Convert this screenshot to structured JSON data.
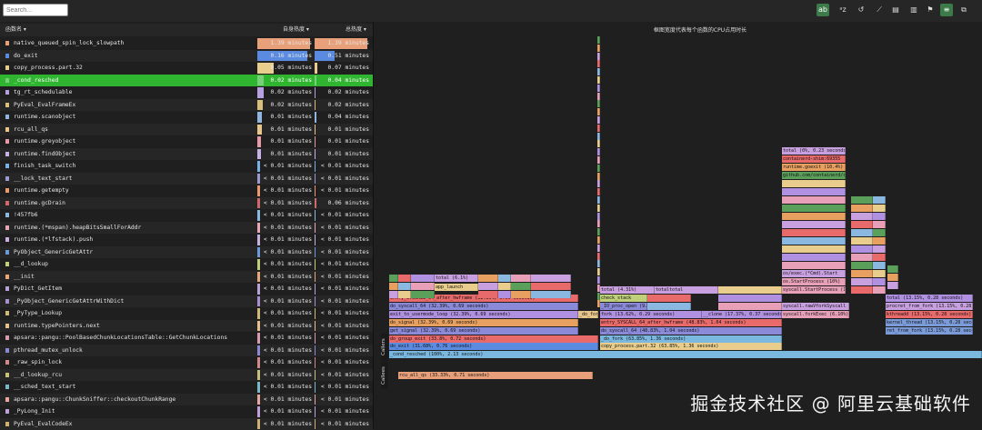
{
  "search": {
    "placeholder": "Search..."
  },
  "toolbar": {
    "buttons": [
      {
        "label": "ab",
        "icon": "match-case-icon",
        "active": true
      },
      {
        "label": "ᵃz",
        "icon": "sort-alpha-icon",
        "active": false
      },
      {
        "label": "↺",
        "icon": "reset-icon",
        "active": false
      },
      {
        "label": "⟋",
        "icon": "highlight-icon",
        "active": false
      },
      {
        "label": "▤",
        "icon": "table-icon",
        "active": false
      },
      {
        "label": "▥",
        "icon": "split-icon",
        "active": false
      },
      {
        "label": "⚑",
        "icon": "flag-icon",
        "active": false
      },
      {
        "label": "≡",
        "icon": "flamegraph-icon",
        "active": true
      },
      {
        "label": "⧉",
        "icon": "graph-icon",
        "active": false
      }
    ]
  },
  "table": {
    "col_name": "函数名 ▾",
    "col_self": "自身热度 ▾",
    "col_total": "总热度 ▾",
    "rows": [
      {
        "name": "native_queued_spin_lock_slowpath",
        "self": "1.39 minutes",
        "total": "1.39 minutes",
        "color": "#e8a07a",
        "self_frac": 0.96,
        "total_frac": 0.96
      },
      {
        "name": "do_exit",
        "self": "0.16 minutes",
        "total": "0.51 minutes",
        "color": "#5b8be0",
        "self_frac": 0.92,
        "total_frac": 0.36
      },
      {
        "name": "copy_process.part.32",
        "self": "0.05 minutes",
        "total": "0.07 minutes",
        "color": "#e8cd8c",
        "self_frac": 0.3,
        "total_frac": 0.05
      },
      {
        "name": "_cond_resched",
        "self": "0.02 minutes",
        "total": "0.04 minutes",
        "color": "#7ad07a",
        "self_frac": 0.12,
        "total_frac": 0.03
      },
      {
        "name": "tg_rt_schedulable",
        "self": "0.02 minutes",
        "total": "0.02 minutes",
        "color": "#b6a0e0",
        "self_frac": 0.12,
        "total_frac": 0.02
      },
      {
        "name": "PyEval_EvalFrameEx",
        "self": "0.02 minutes",
        "total": "0.02 minutes",
        "color": "#d8c07a",
        "self_frac": 0.1,
        "total_frac": 0.02
      },
      {
        "name": "runtime.scanobject",
        "self": "0.01 minutes",
        "total": "0.04 minutes",
        "color": "#8fb5e0",
        "self_frac": 0.09,
        "total_frac": 0.03
      },
      {
        "name": "rcu_all_qs",
        "self": "0.01 minutes",
        "total": "0.01 minutes",
        "color": "#e8c58a",
        "self_frac": 0.08,
        "total_frac": 0.01
      },
      {
        "name": "runtime.greyobject",
        "self": "0.01 minutes",
        "total": "0.01 minutes",
        "color": "#e89aa8",
        "self_frac": 0.07,
        "total_frac": 0.01
      },
      {
        "name": "runtime.findObject",
        "self": "0.01 minutes",
        "total": "0.01 minutes",
        "color": "#c8b0e8",
        "self_frac": 0.06,
        "total_frac": 0.01
      },
      {
        "name": "finish_task_switch",
        "self": "< 0.01 minutes",
        "total": "< 0.01 minutes",
        "color": "#7ab0e8",
        "self_frac": 0.05,
        "total_frac": 0.005
      },
      {
        "name": "__lock_text_start",
        "self": "< 0.01 minutes",
        "total": "< 0.01 minutes",
        "color": "#9a9ad0",
        "self_frac": 0.05,
        "total_frac": 0.005
      },
      {
        "name": "runtime.getempty",
        "self": "< 0.01 minutes",
        "total": "< 0.01 minutes",
        "color": "#e89a6a",
        "self_frac": 0.04,
        "total_frac": 0.005
      },
      {
        "name": "runtime.gcDrain",
        "self": "< 0.01 minutes",
        "total": "0.06 minutes",
        "color": "#d06a6a",
        "self_frac": 0.04,
        "total_frac": 0.04
      },
      {
        "name": "!457fb6",
        "self": "< 0.01 minutes",
        "total": "< 0.01 minutes",
        "color": "#8ab8e0",
        "self_frac": 0.03,
        "total_frac": 0.005
      },
      {
        "name": "runtime.(*mspan).heapBitsSmallForAddr",
        "self": "< 0.01 minutes",
        "total": "< 0.01 minutes",
        "color": "#e8a8b8",
        "self_frac": 0.03,
        "total_frac": 0.005
      },
      {
        "name": "runtime.(*lfstack).push",
        "self": "< 0.01 minutes",
        "total": "< 0.01 minutes",
        "color": "#c8b0e0",
        "self_frac": 0.03,
        "total_frac": 0.005
      },
      {
        "name": "PyObject_GenericGetAttr",
        "self": "< 0.01 minutes",
        "total": "< 0.01 minutes",
        "color": "#6a9ad8",
        "self_frac": 0.03,
        "total_frac": 0.005
      },
      {
        "name": "__d_lookup",
        "self": "< 0.01 minutes",
        "total": "< 0.01 minutes",
        "color": "#c0d07a",
        "self_frac": 0.02,
        "total_frac": 0.005
      },
      {
        "name": "__init",
        "self": "< 0.01 minutes",
        "total": "< 0.01 minutes",
        "color": "#e8a878",
        "self_frac": 0.02,
        "total_frac": 0.005
      },
      {
        "name": "PyDict_GetItem",
        "self": "< 0.01 minutes",
        "total": "< 0.01 minutes",
        "color": "#b8a0d8",
        "self_frac": 0.02,
        "total_frac": 0.005
      },
      {
        "name": "_PyObject_GenericGetAttrWithDict",
        "self": "< 0.01 minutes",
        "total": "< 0.01 minutes",
        "color": "#a890d0",
        "self_frac": 0.02,
        "total_frac": 0.005
      },
      {
        "name": "_PyType_Lookup",
        "self": "< 0.01 minutes",
        "total": "< 0.01 minutes",
        "color": "#d0b878",
        "self_frac": 0.02,
        "total_frac": 0.005
      },
      {
        "name": "runtime.typePointers.next",
        "self": "< 0.01 minutes",
        "total": "< 0.01 minutes",
        "color": "#e8c090",
        "self_frac": 0.02,
        "total_frac": 0.005
      },
      {
        "name": "apsara::pangu::PoolBasedChunkLocationsTable::GetChunkLocations",
        "self": "< 0.01 minutes",
        "total": "< 0.01 minutes",
        "color": "#d89ab0",
        "self_frac": 0.02,
        "total_frac": 0.005
      },
      {
        "name": "pthread_mutex_unlock",
        "self": "< 0.01 minutes",
        "total": "< 0.01 minutes",
        "color": "#8a8ad0",
        "self_frac": 0.02,
        "total_frac": 0.005
      },
      {
        "name": "_raw_spin_lock",
        "self": "< 0.01 minutes",
        "total": "< 0.01 minutes",
        "color": "#d08a8a",
        "self_frac": 0.02,
        "total_frac": 0.005
      },
      {
        "name": "__d_lookup_rcu",
        "self": "< 0.01 minutes",
        "total": "< 0.01 minutes",
        "color": "#c8c07a",
        "self_frac": 0.02,
        "total_frac": 0.005
      },
      {
        "name": "__sched_text_start",
        "self": "< 0.01 minutes",
        "total": "< 0.01 minutes",
        "color": "#7ab8c8",
        "self_frac": 0.02,
        "total_frac": 0.005
      },
      {
        "name": "apsara::pangu::ChunkSniffer::checkoutChunkRange",
        "self": "< 0.01 minutes",
        "total": "< 0.01 minutes",
        "color": "#e8a8a0",
        "self_frac": 0.02,
        "total_frac": 0.005
      },
      {
        "name": "_PyLong_Init",
        "self": "< 0.01 minutes",
        "total": "< 0.01 minutes",
        "color": "#c0a0d8",
        "self_frac": 0.02,
        "total_frac": 0.005
      },
      {
        "name": "PyEval_EvalCodeEx",
        "self": "< 0.01 minutes",
        "total": "< 0.01 minutes",
        "color": "#d0b070",
        "self_frac": 0.02,
        "total_frac": 0.005
      }
    ]
  },
  "flame": {
    "title": "框图宽度代表每个函数的CPU占用时长",
    "callers_label": "Callers",
    "callees_label": "Callees",
    "frames": [
      {
        "label": "do_exit (31.68%, 0.76 seconds)",
        "color": "#5b8be0"
      },
      {
        "label": "_cond_resched (100%, 2.13 seconds)",
        "color": "#7ab8e0"
      },
      {
        "label": "_do_fork (63.85%, 1.36 seconds)",
        "color": "#7ab8e0"
      },
      {
        "label": "copy_process.part.32 (63.85%, 1.36 seconds)",
        "color": "#e8cd8c"
      },
      {
        "label": "do_syscall_64 (48.83%, 1.04 seconds)",
        "color": "#8a8ad8"
      },
      {
        "label": "entry_SYSCALL_64_after_hwframe (48.83%, 1.04 seconds)",
        "color": "#e86a6a"
      },
      {
        "label": "fork (13.62%, 0.29 seconds)",
        "color": "#b090e0"
      },
      {
        "label": "__clone (17.37%, 0.37 seconds)",
        "color": "#b090e0"
      },
      {
        "label": "syscall.forkExec (6.10%)",
        "color": "#e8a0b8"
      },
      {
        "label": "syscall.rawVforkSyscall",
        "color": "#c8a0e0"
      },
      {
        "label": "do_group_exit (33.8%, 0.72 seconds)",
        "color": "#e86a6a"
      },
      {
        "label": "get_signal (32.39%, 0.69 seconds)",
        "color": "#8a8ad8"
      },
      {
        "label": "do_signal (32.39%, 0.69 seconds)",
        "color": "#e8a060"
      },
      {
        "label": "exit_to_usermode_loop (32.39%, 0.69 seconds)",
        "color": "#b090e0"
      },
      {
        "label": "do_syscall_64 (32.39%, 0.69 seconds)",
        "color": "#8a8ad8"
      },
      {
        "label": "entry_SYSCALL_64_after_hwframe (32.39%, 0.69 seconds)",
        "color": "#e86a6a"
      },
      {
        "label": "rcu_all_qs (33.33%, 0.71 seconds)",
        "color": "#e8a07a"
      },
      {
        "label": "_do_fork",
        "color": "#e8c58a"
      },
      {
        "label": "ret_from_fork (13.15%, 0.28 seconds)",
        "color": "#7a9ad8"
      },
      {
        "label": "kernel_thread (13.15%, 0.28 seconds)",
        "color": "#7a9ad8"
      },
      {
        "label": "kthreadd (13.15%, 0.28 seconds)",
        "color": "#e86a6a"
      },
      {
        "label": "procret_from_fork (13.15%, 0.28 seconds)",
        "color": "#c8a0e0"
      },
      {
        "label": "total (13.15%, 0.28 seconds)",
        "color": "#b090e0"
      },
      {
        "label": "total (0%, 0.23 seconds)",
        "color": "#c8a0e0"
      },
      {
        "label": "containerd-shim:69355",
        "color": "#e86a6a"
      },
      {
        "label": "runtime.goexit (10.4%)",
        "color": "#e8a060"
      },
      {
        "label": "github.com/containerd/c",
        "color": "#5aa05a"
      },
      {
        "label": "os.StartProcess (10%)",
        "color": "#e8a0b8"
      },
      {
        "label": "os/exec.(*Cmd).Start",
        "color": "#c8a0e0"
      },
      {
        "label": "syscall.StartProcess (10%)",
        "color": "#e8a0b8"
      },
      {
        "label": "check_stack",
        "color": "#c0d07a"
      },
      {
        "label": "_IO_proc_open (9.86%)",
        "color": "#8a8ad8"
      },
      {
        "label": "total (4.31%)",
        "color": "#c8a0e0"
      },
      {
        "label": "total (6.1%)",
        "color": "#c8a0e0"
      },
      {
        "label": "app_launch",
        "color": "#e8cd8c"
      },
      {
        "label": "totaltotal",
        "color": "#c8a0e0"
      }
    ]
  },
  "watermark": "掘金技术社区 @ 阿里云基础软件"
}
